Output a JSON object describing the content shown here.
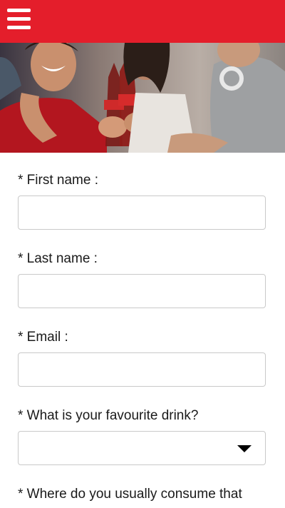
{
  "header": {
    "menu_icon": "hamburger-menu-icon",
    "brand_color": "#e41e2b"
  },
  "hero": {
    "image": "people-toasting-coca-cola-bottles"
  },
  "form": {
    "first_name": {
      "label": "* First name :",
      "value": ""
    },
    "last_name": {
      "label": "* Last name :",
      "value": ""
    },
    "email": {
      "label": "* Email :",
      "value": ""
    },
    "favourite_drink": {
      "label": "* What is your favourite drink?",
      "selected": ""
    },
    "consume_location": {
      "label": "* Where do you usually consume that"
    }
  }
}
